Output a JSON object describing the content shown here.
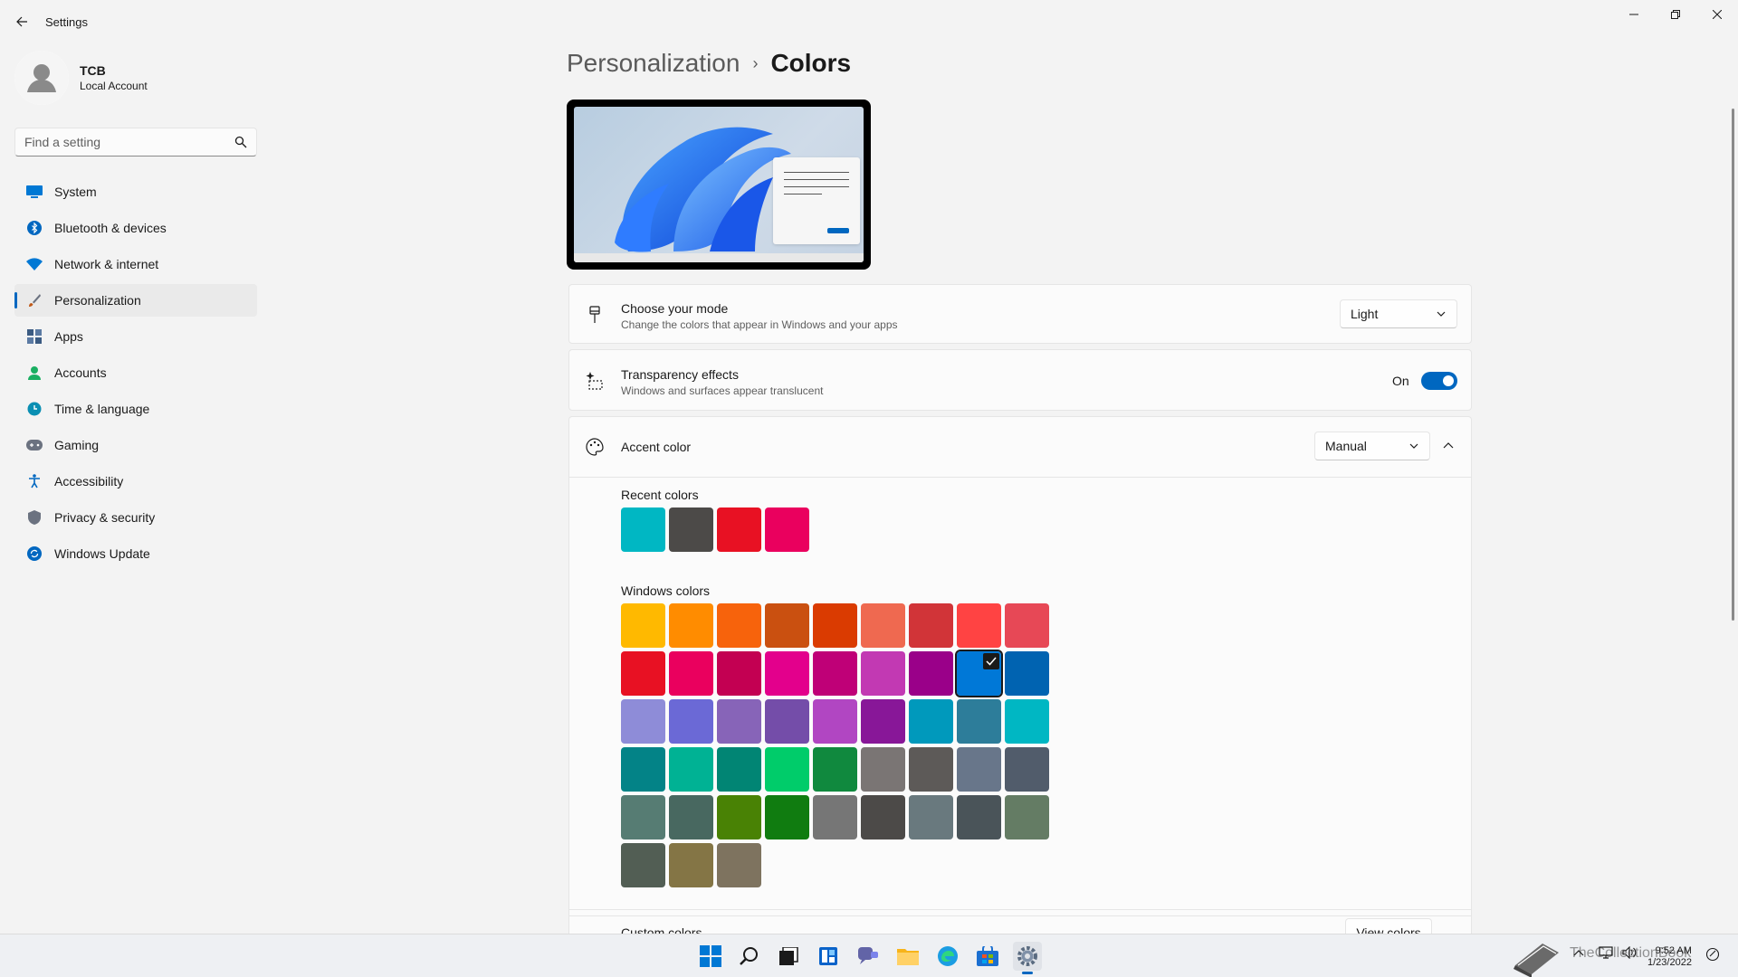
{
  "window": {
    "title": "Settings",
    "back_icon": "arrow-left-icon",
    "controls": [
      "minimize-icon",
      "maximize-icon",
      "close-icon"
    ]
  },
  "profile": {
    "name": "TCB",
    "account_type": "Local Account"
  },
  "search": {
    "placeholder": "Find a setting"
  },
  "sidebar": {
    "items": [
      {
        "label": "System",
        "icon": "monitor-icon",
        "color": "#0078d4",
        "active": false
      },
      {
        "label": "Bluetooth & devices",
        "icon": "bluetooth-icon",
        "color": "#0067c0",
        "active": false
      },
      {
        "label": "Network & internet",
        "icon": "wifi-icon",
        "color": "#0078d4",
        "active": false
      },
      {
        "label": "Personalization",
        "icon": "brush-icon",
        "color": "#c05a1a",
        "active": true
      },
      {
        "label": "Apps",
        "icon": "apps-icon",
        "color": "#3b5b82",
        "active": false
      },
      {
        "label": "Accounts",
        "icon": "person-icon",
        "color": "#1aaf62",
        "active": false
      },
      {
        "label": "Time & language",
        "icon": "clock-globe-icon",
        "color": "#0a8fb3",
        "active": false
      },
      {
        "label": "Gaming",
        "icon": "gamepad-icon",
        "color": "#6b7280",
        "active": false
      },
      {
        "label": "Accessibility",
        "icon": "accessibility-icon",
        "color": "#0067c0",
        "active": false
      },
      {
        "label": "Privacy & security",
        "icon": "shield-icon",
        "color": "#6b7280",
        "active": false
      },
      {
        "label": "Windows Update",
        "icon": "update-icon",
        "color": "#0067c0",
        "active": false
      }
    ]
  },
  "breadcrumb": {
    "parent": "Personalization",
    "separator": "›",
    "current": "Colors"
  },
  "mode": {
    "title": "Choose your mode",
    "subtitle": "Change the colors that appear in Windows and your apps",
    "value": "Light"
  },
  "transparency": {
    "title": "Transparency effects",
    "subtitle": "Windows and surfaces appear translucent",
    "state_label": "On",
    "enabled": true
  },
  "accent": {
    "title": "Accent color",
    "value": "Manual",
    "expanded": true
  },
  "recent_colors": {
    "label": "Recent colors",
    "swatches": [
      "#00b7c3",
      "#4c4a48",
      "#e81123",
      "#ea005e"
    ]
  },
  "windows_colors": {
    "label": "Windows colors",
    "selected": "#0078d7",
    "swatches": [
      "#ffb900",
      "#ff8c00",
      "#f7630c",
      "#ca5010",
      "#da3b01",
      "#ef6950",
      "#d13438",
      "#ff4343",
      "#e74856",
      "#e81123",
      "#ea005e",
      "#c30052",
      "#e3008c",
      "#bf0077",
      "#c239b3",
      "#9a0089",
      "#0078d7",
      "#0063b1",
      "#8e8cd8",
      "#6b69d6",
      "#8764b8",
      "#744da9",
      "#b146c2",
      "#881798",
      "#0099bc",
      "#2d7d9a",
      "#00b7c3",
      "#038387",
      "#00b294",
      "#018574",
      "#00cc6a",
      "#10893e",
      "#7a7574",
      "#5d5a58",
      "#68768a",
      "#515c6b",
      "#567c73",
      "#486860",
      "#498205",
      "#107c10",
      "#767676",
      "#4c4a48",
      "#69797e",
      "#4a5459",
      "#647c64",
      "#525e54",
      "#847545",
      "#7e735f"
    ]
  },
  "custom_colors": {
    "label": "Custom colors",
    "button": "View colors"
  },
  "taskbar": {
    "icons": [
      "windows-start-icon",
      "search-icon",
      "task-view-icon",
      "widgets-icon",
      "chat-icon",
      "file-explorer-icon",
      "edge-icon",
      "store-icon",
      "settings-icon"
    ],
    "time": "9:52 AM",
    "date": "1/23/2022",
    "watermark": "TheCollectionBook"
  }
}
